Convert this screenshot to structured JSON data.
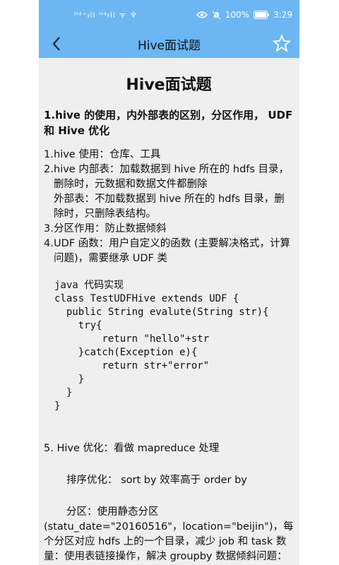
{
  "status": {
    "left_icons": "ᴴᵈ⁺ıll ᴴᵈıll ᯤ ♆",
    "battery_percent": "100%",
    "time": "3:29"
  },
  "appbar": {
    "title": "Hive面试题"
  },
  "content": {
    "doc_title": "Hive面试题",
    "section_heading": "1.hive 的使用，内外部表的区别，分区作用， UDF 和 Hive 优化",
    "items": [
      {
        "num": "1.",
        "text": "hive 使用：仓库、工具"
      },
      {
        "num": "2.",
        "text": "hive 内部表：加载数据到 hive 所在的 hdfs 目录，删除时，元数据和数据文件都删除"
      },
      {
        "num": "",
        "text": "外部表：不加载数据到 hive 所在的 hdfs 目录，删除时，只删除表结构。"
      },
      {
        "num": "3.",
        "text": "分区作用：防止数据倾斜"
      },
      {
        "num": "4.",
        "text": "UDF 函数：用户自定义的函数 (主要解决格式，计算问题)，需要继承 UDF 类"
      }
    ],
    "code": "java 代码实现\nclass TestUDFHive extends UDF {\n  public String evalute(String str){\n    try{\n        return \"hello\"+str\n    }catch(Exception e){\n        return str+\"error\"\n    }\n  }\n}",
    "opt_item": "5. Hive 优化：看做 mapreduce 处理",
    "sort_line": "排序优化： sort by 效率高于 order by",
    "partition_line_1": "分区：使用静态分区",
    "partition_line_2": "(statu_date=\"20160516\"，location=\"beijin\")，每个分区对应 hdfs 上的一个目录，减少 job 和 task 数量：使用表链接操作，解决 groupby 数据倾斜问题：设置 hive.groupby.skewindata=true ，那么"
  }
}
